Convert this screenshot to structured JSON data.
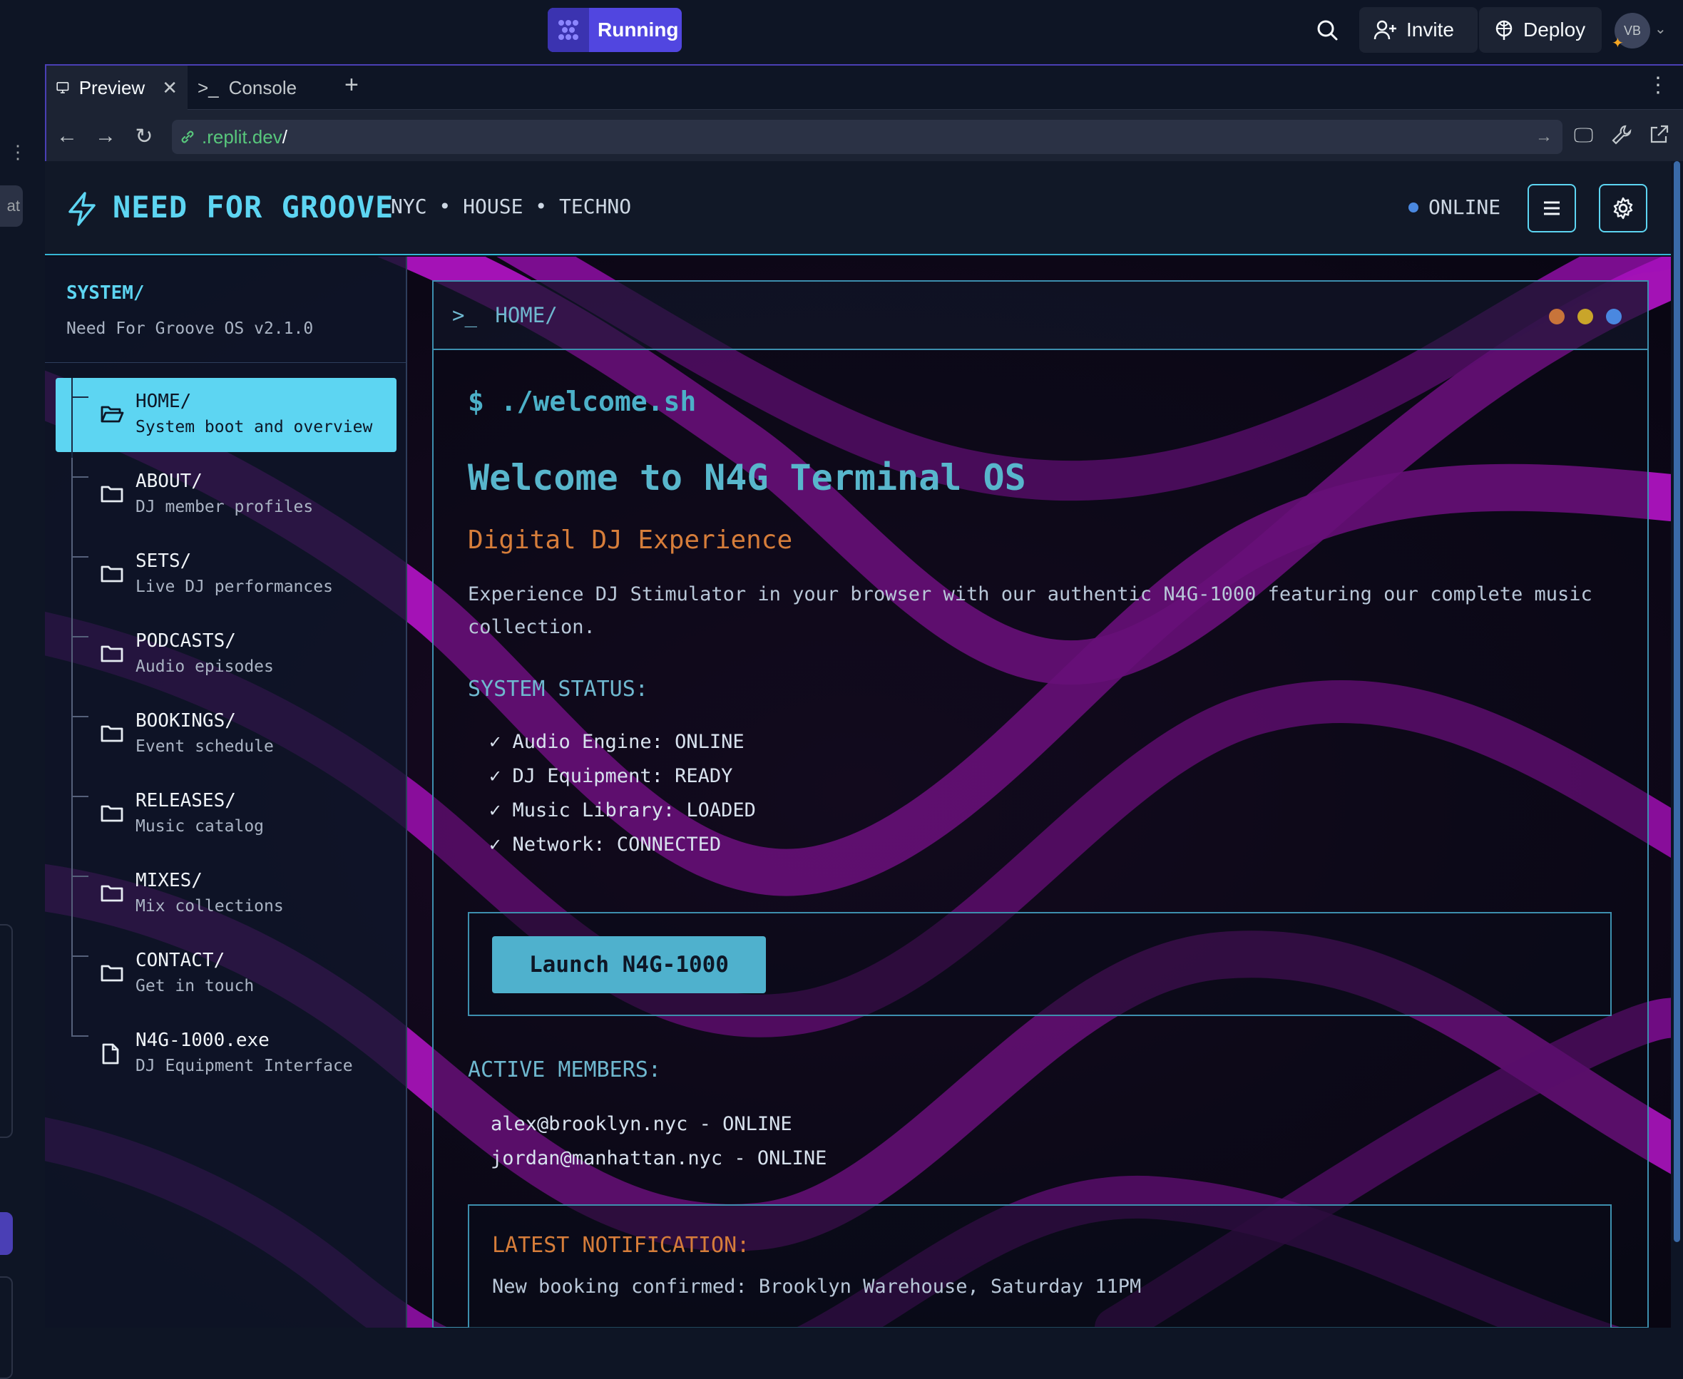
{
  "replit": {
    "run_label": "Running",
    "invite_label": "Invite",
    "deploy_label": "Deploy",
    "avatar_initials": "VB",
    "accent": "#5146e0",
    "tabs": [
      {
        "label": "Preview",
        "icon": "monitor-icon"
      },
      {
        "label": "Console",
        "icon": "terminal-icon"
      }
    ],
    "url_text": ".replit.dev",
    "url_slash": "/",
    "strip_label": "at"
  },
  "app": {
    "brand": "NEED FOR GROOVE",
    "tagline": "NYC • HOUSE • TECHNO",
    "status": "ONLINE",
    "accent": "#5dd5f2",
    "sidebar": {
      "title": "SYSTEM/",
      "version": "Need For Groove OS v2.1.0",
      "items": [
        {
          "name": "HOME/",
          "desc": "System boot and overview",
          "icon": "folder-open-icon",
          "active": true
        },
        {
          "name": "ABOUT/",
          "desc": "DJ member profiles",
          "icon": "folder-icon"
        },
        {
          "name": "SETS/",
          "desc": "Live DJ performances",
          "icon": "folder-icon"
        },
        {
          "name": "PODCASTS/",
          "desc": "Audio episodes",
          "icon": "folder-icon"
        },
        {
          "name": "BOOKINGS/",
          "desc": "Event schedule",
          "icon": "folder-icon"
        },
        {
          "name": "RELEASES/",
          "desc": "Music catalog",
          "icon": "folder-icon"
        },
        {
          "name": "MIXES/",
          "desc": "Mix collections",
          "icon": "folder-icon"
        },
        {
          "name": "CONTACT/",
          "desc": "Get in touch",
          "icon": "folder-icon"
        },
        {
          "name": "N4G-1000.exe",
          "desc": "DJ Equipment Interface",
          "icon": "file-icon"
        }
      ]
    },
    "terminal": {
      "prompt_symbol": ">_",
      "path": "HOME/",
      "command": "$ ./welcome.sh",
      "welcome": "Welcome to N4G Terminal OS",
      "subtitle": "Digital DJ Experience",
      "description": "Experience DJ Stimulator in your browser with our authentic N4G-1000 featuring our complete music collection.",
      "status_title": "SYSTEM STATUS:",
      "status_lines": [
        "✓ Audio Engine: ONLINE",
        "✓ DJ Equipment: READY",
        "✓ Music Library: LOADED",
        "✓ Network: CONNECTED"
      ],
      "launch_label": "Launch N4G-1000",
      "members_title": "ACTIVE MEMBERS:",
      "members": [
        "alex@brooklyn.nyc - ONLINE",
        "jordan@manhattan.nyc - ONLINE"
      ],
      "notification_title": "LATEST NOTIFICATION:",
      "notification_text": "New booking confirmed: Brooklyn Warehouse, Saturday 11PM",
      "window_dots": [
        "#c8743a",
        "#c9a52a",
        "#4a88e0"
      ]
    }
  }
}
